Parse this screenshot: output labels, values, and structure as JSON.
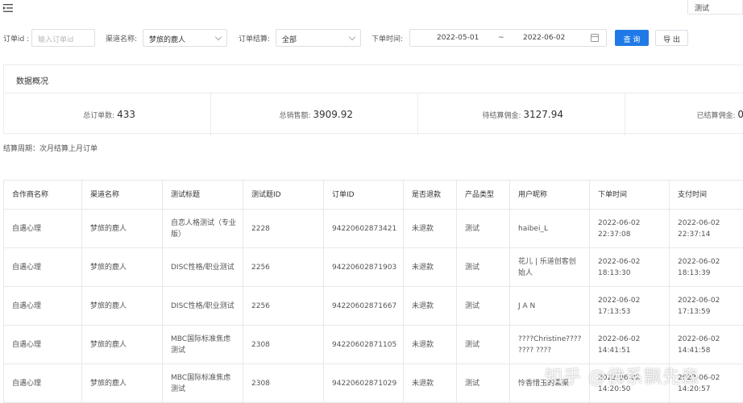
{
  "header": {
    "menu_icon": "menu-fold-icon",
    "user_label": "测试"
  },
  "filters": {
    "order_id_label": "订单id :",
    "order_id_placeholder": "输入订单id",
    "channel_label": "渠道名称:",
    "channel_value": "梦旅的鹿人",
    "settlement_label": "订单结算:",
    "settlement_value": "全部",
    "date_label": "下单时间:",
    "date_start": "2022-05-01",
    "date_sep": "~",
    "date_end": "2022-06-02",
    "query_button": "查 询",
    "export_button": "导 出"
  },
  "overview": {
    "title": "数据概况",
    "stats": [
      {
        "label": "总订单数:",
        "value": "433"
      },
      {
        "label": "总销售额:",
        "value": "3909.92"
      },
      {
        "label": "待结算佣金:",
        "value": "3127.94"
      },
      {
        "label": "已结算佣金:",
        "value": "0"
      }
    ]
  },
  "cycle_note": "结算周期：次月结算上月订单",
  "table": {
    "columns": [
      "合作商名称",
      "渠道名称",
      "测试标题",
      "测试题ID",
      "订单ID",
      "是否退款",
      "产品类型",
      "用户昵称",
      "下单时间",
      "支付时间"
    ],
    "rows": [
      [
        "自遇心理",
        "梦旅的鹿人",
        "自恋人格测试（专业版）",
        "2228",
        "94220602873421",
        "未退款",
        "测试",
        "haibei_L",
        "2022-06-02 22:37:08",
        "2022-06-02 22:37:14"
      ],
      [
        "自遇心理",
        "梦旅的鹿人",
        "DISC性格/职业测试",
        "2256",
        "94220602871903",
        "未退款",
        "测试",
        "花儿 | 乐道创客创始人",
        "2022-06-02 18:13:30",
        "2022-06-02 18:13:39"
      ],
      [
        "自遇心理",
        "梦旅的鹿人",
        "DISC性格/职业测试",
        "2256",
        "94220602871667",
        "未退款",
        "测试",
        "J A N",
        "2022-06-02 17:13:53",
        "2022-06-02 17:13:59"
      ],
      [
        "自遇心理",
        "梦旅的鹿人",
        "MBC国际标准焦虑测试",
        "2308",
        "94220602871105",
        "未退款",
        "测试",
        "????Christine???? ???? ????",
        "2022-06-02 14:41:51",
        "2022-06-02 14:41:58"
      ],
      [
        "自遇心理",
        "梦旅的鹿人",
        "MBC国际标准焦虑测试",
        "2308",
        "94220602871029",
        "未退款",
        "测试",
        "怜香惜玉的瀛渠",
        "2022-06-02 14:20:50",
        "2022-06-02 14:20:57"
      ]
    ]
  },
  "watermark": "知乎 @佛系飘先森"
}
